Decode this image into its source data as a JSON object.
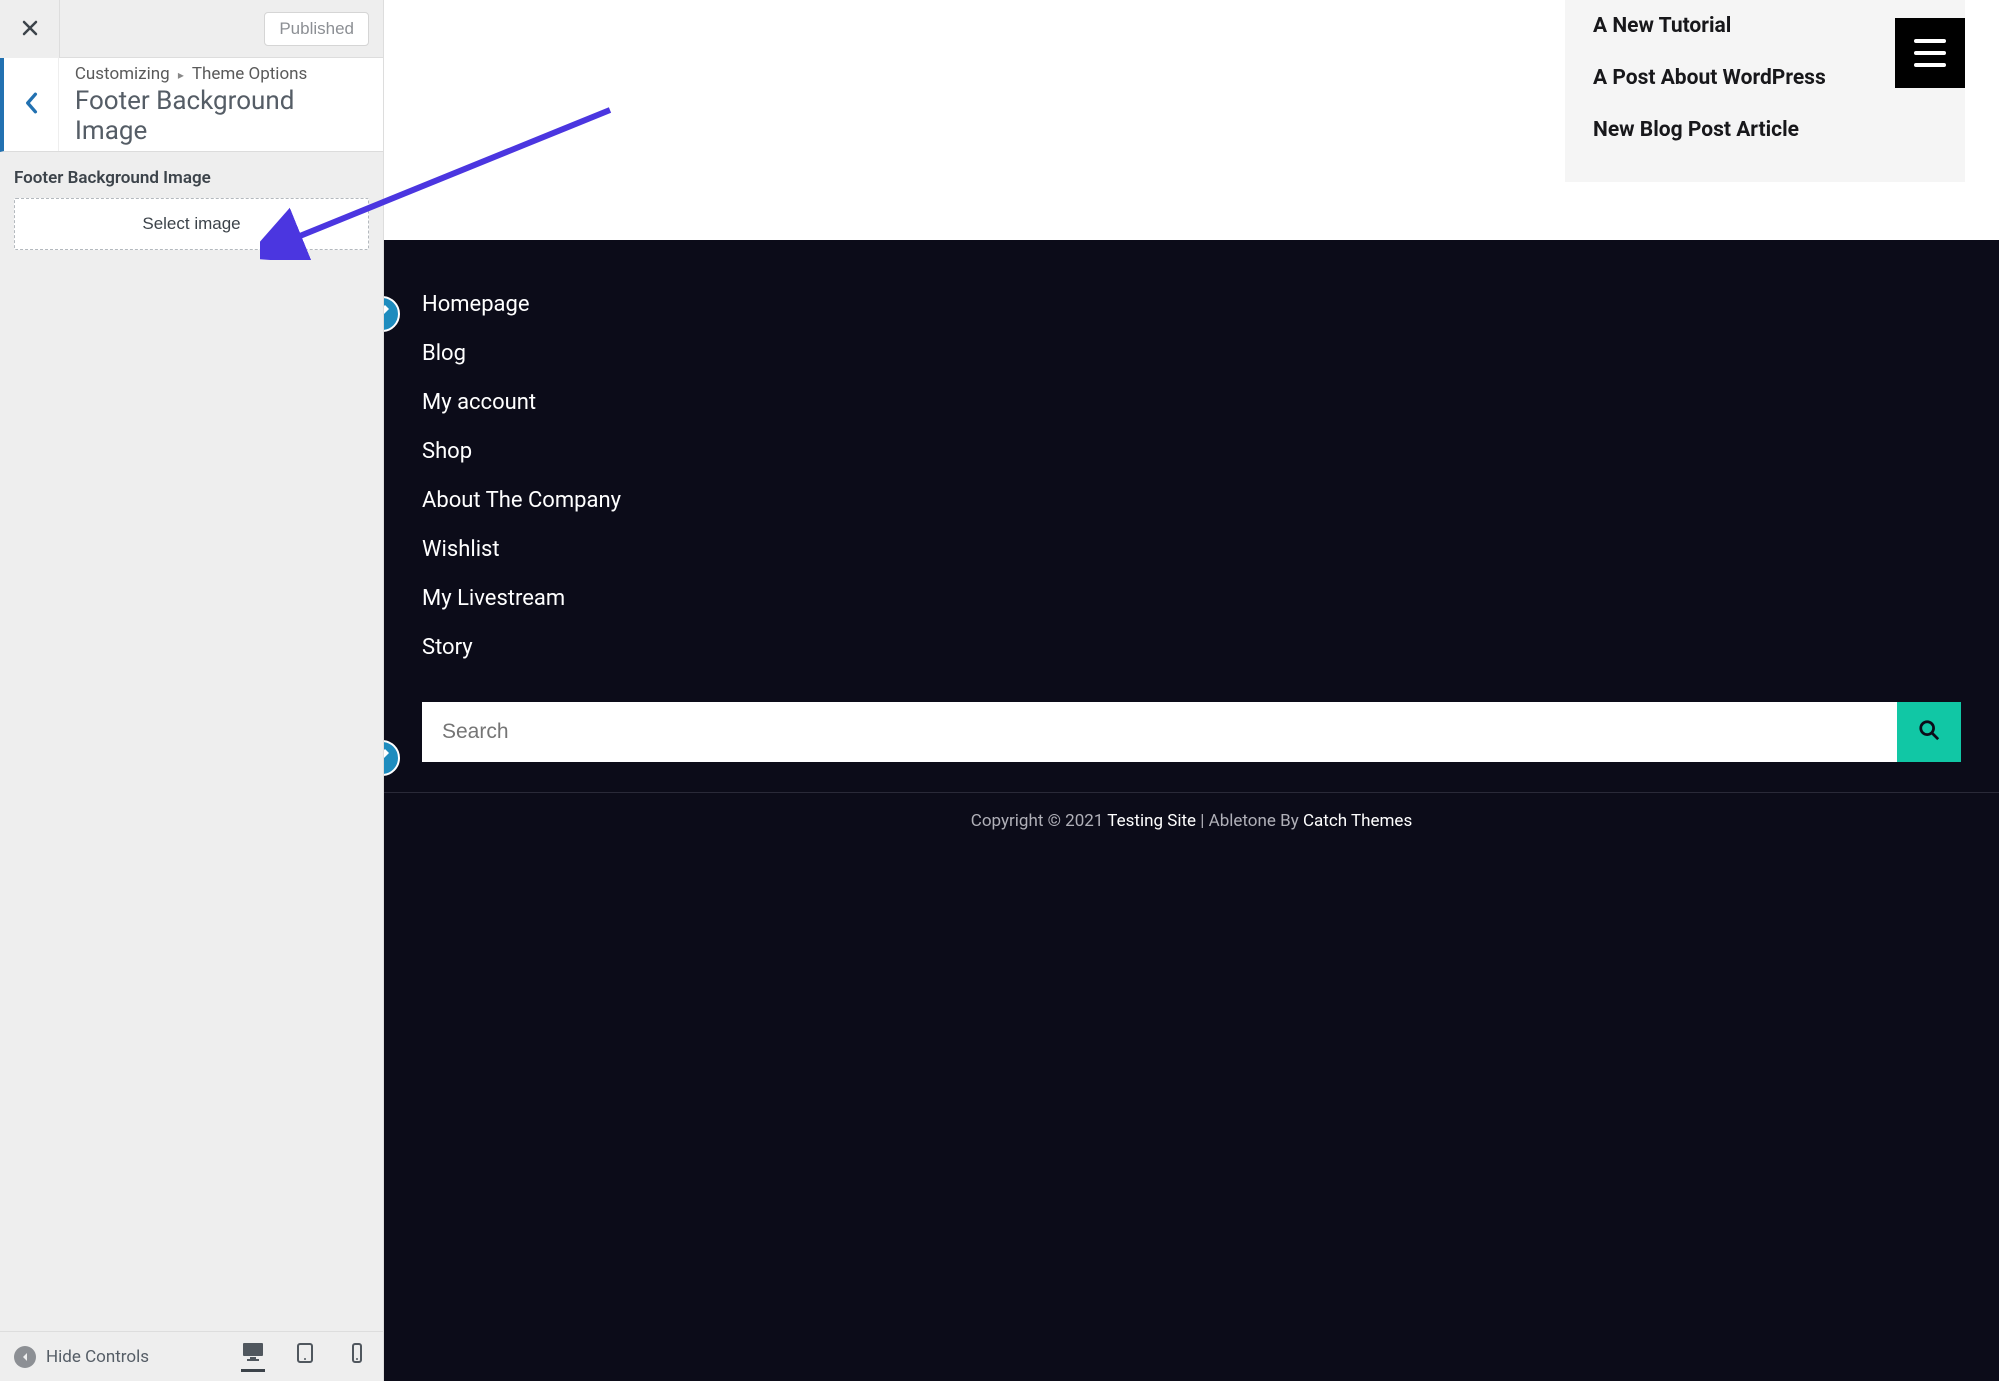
{
  "sidebar": {
    "published_label": "Published",
    "breadcrumb_root": "Customizing",
    "breadcrumb_section": "Theme Options",
    "panel_title": "Footer Background Image",
    "control_label": "Footer Background Image",
    "select_image_label": "Select image",
    "hide_controls_label": "Hide Controls"
  },
  "preview": {
    "recent_posts": [
      "A New Tutorial",
      "A Post About WordPress",
      "New Blog Post Article"
    ],
    "footer_nav": [
      "Homepage",
      "Blog",
      "My account",
      "Shop",
      "About The Company",
      "Wishlist",
      "My Livestream",
      "Story"
    ],
    "search_placeholder": "Search",
    "copyright_prefix": "Copyright © 2021 ",
    "copyright_site": "Testing Site",
    "copyright_mid": " | Abletone By ",
    "copyright_author": "Catch Themes"
  },
  "colors": {
    "arrow": "#4b36e0",
    "search_btn": "#11c7a5",
    "edit_dot": "#1e8cbe",
    "footer_bg": "#0c0c19"
  }
}
